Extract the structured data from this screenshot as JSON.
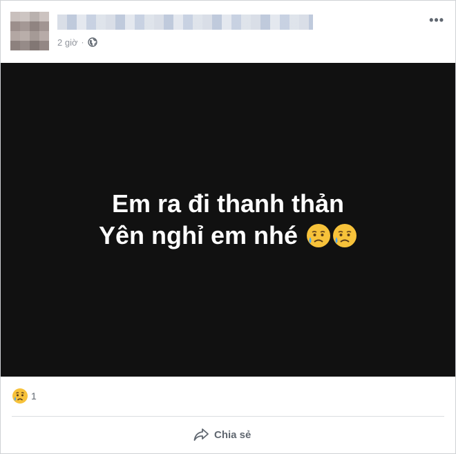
{
  "post": {
    "author_name": "",
    "timestamp": "2 giờ",
    "separator": "·",
    "audience_icon": "globe-icon",
    "more_label": "•••",
    "media": {
      "line1": "Em ra đi thanh thản",
      "line2": "Yên nghỉ em nhé",
      "emoji": "sad-relieved-face-emoji"
    },
    "reactions": {
      "icon": "sad-reaction-icon",
      "count": "1"
    },
    "actions": {
      "share_label": "Chia sẻ",
      "share_icon": "share-arrow-icon"
    },
    "colors": {
      "media_background": "#111111",
      "muted_text": "#90949c",
      "action_text": "#606770"
    }
  }
}
